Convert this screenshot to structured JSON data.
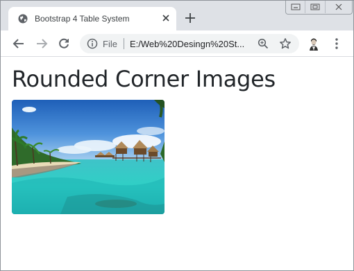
{
  "browser": {
    "tab": {
      "title": "Bootstrap 4 Table System",
      "favicon": "globe-icon"
    },
    "address_bar": {
      "scheme_label": "File",
      "url": "E:/Web%20Desingn%20St..."
    },
    "window_controls": [
      "minimize-icon",
      "restore-icon",
      "close-icon"
    ],
    "toolbar_icons": [
      "back-arrow-icon",
      "forward-arrow-icon",
      "reload-icon",
      "info-icon",
      "zoom-icon",
      "star-icon",
      "avatar",
      "kebab-menu-icon"
    ]
  },
  "page": {
    "heading": "Rounded Corner Images",
    "image": {
      "subject": "tropical beach with overwater bungalows",
      "rounded": true
    }
  },
  "colors": {
    "tabstrip": "#dee1e6",
    "heading": "#212529",
    "omnibox": "#f1f3f4"
  }
}
